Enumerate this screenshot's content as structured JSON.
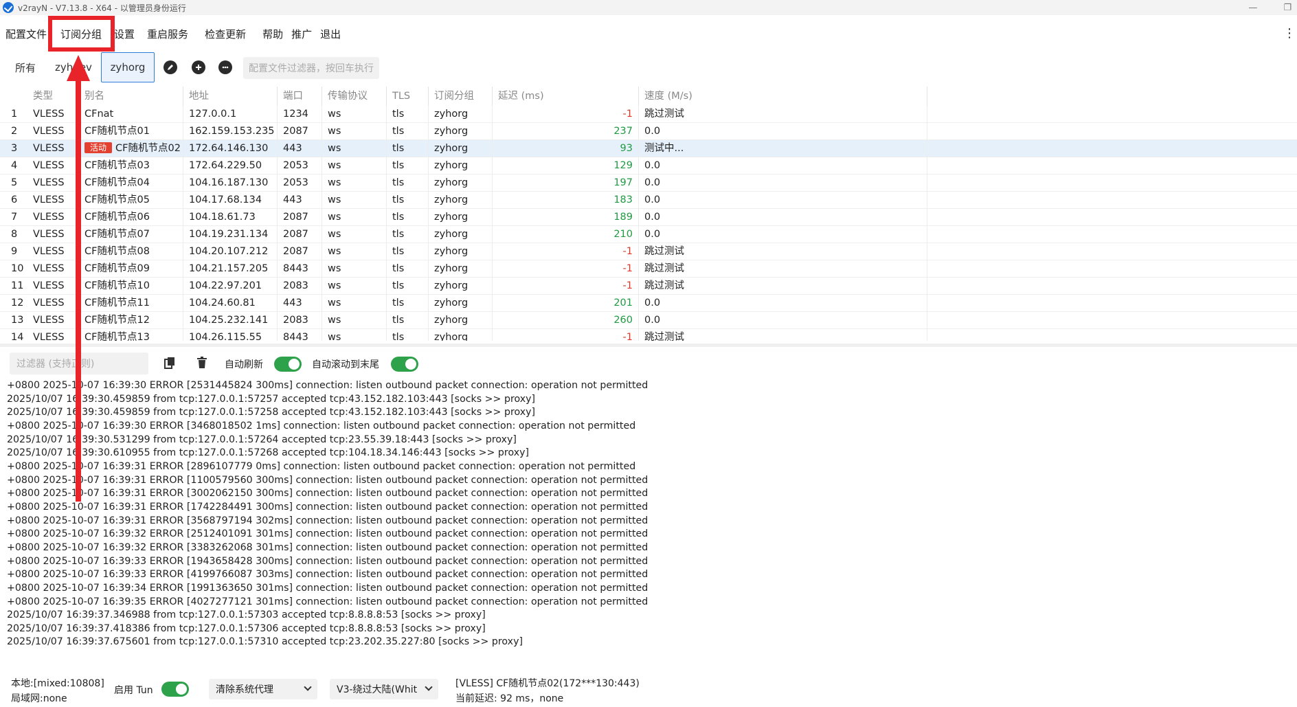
{
  "window": {
    "title": "v2rayN - V7.13.8 - X64 - 以管理员身份运行",
    "minimize": "—",
    "maximize": "❐"
  },
  "menu": [
    {
      "label": "配置文件"
    },
    {
      "label": "订阅分组"
    },
    {
      "label": "设置"
    },
    {
      "label": "重启服务"
    },
    {
      "label": "检查更新"
    },
    {
      "label": "帮助"
    },
    {
      "label": "推广"
    },
    {
      "label": "退出"
    }
  ],
  "menu_overflow": "⋮",
  "tabs": [
    {
      "label": "所有"
    },
    {
      "label": "zyhdev"
    },
    {
      "label": "zyhorg",
      "active": true
    }
  ],
  "toolbar_icons": [
    "edit-icon",
    "add-icon",
    "more-icon"
  ],
  "profile_filter": {
    "placeholder": "配置文件过滤器，按回车执行"
  },
  "table": {
    "columns": [
      "类型",
      "别名",
      "地址",
      "端口",
      "传输协议",
      "TLS",
      "订阅分组",
      "延迟 (ms)",
      "速度 (M/s)"
    ],
    "rows": [
      {
        "idx": "1",
        "type": "VLESS",
        "alias": "CFnat",
        "address": "127.0.0.1",
        "port": "1234",
        "transport": "ws",
        "tls": "tls",
        "group": "zyhorg",
        "latency": "-1",
        "speed": "跳过测试"
      },
      {
        "idx": "2",
        "type": "VLESS",
        "alias": "CF随机节点01",
        "address": "162.159.153.235",
        "port": "2087",
        "transport": "ws",
        "tls": "tls",
        "group": "zyhorg",
        "latency": "237",
        "speed": "0.0"
      },
      {
        "idx": "3",
        "type": "VLESS",
        "alias": "CF随机节点02",
        "badge": "活动",
        "address": "172.64.146.130",
        "port": "443",
        "transport": "ws",
        "tls": "tls",
        "group": "zyhorg",
        "latency": "93",
        "speed": "测试中...",
        "selected": true
      },
      {
        "idx": "4",
        "type": "VLESS",
        "alias": "CF随机节点03",
        "address": "172.64.229.50",
        "port": "2053",
        "transport": "ws",
        "tls": "tls",
        "group": "zyhorg",
        "latency": "129",
        "speed": "0.0"
      },
      {
        "idx": "5",
        "type": "VLESS",
        "alias": "CF随机节点04",
        "address": "104.16.187.130",
        "port": "2053",
        "transport": "ws",
        "tls": "tls",
        "group": "zyhorg",
        "latency": "197",
        "speed": "0.0"
      },
      {
        "idx": "6",
        "type": "VLESS",
        "alias": "CF随机节点05",
        "address": "104.17.68.134",
        "port": "443",
        "transport": "ws",
        "tls": "tls",
        "group": "zyhorg",
        "latency": "183",
        "speed": "0.0"
      },
      {
        "idx": "7",
        "type": "VLESS",
        "alias": "CF随机节点06",
        "address": "104.18.61.73",
        "port": "2087",
        "transport": "ws",
        "tls": "tls",
        "group": "zyhorg",
        "latency": "189",
        "speed": "0.0"
      },
      {
        "idx": "8",
        "type": "VLESS",
        "alias": "CF随机节点07",
        "address": "104.19.231.134",
        "port": "2087",
        "transport": "ws",
        "tls": "tls",
        "group": "zyhorg",
        "latency": "210",
        "speed": "0.0"
      },
      {
        "idx": "9",
        "type": "VLESS",
        "alias": "CF随机节点08",
        "address": "104.20.107.212",
        "port": "2087",
        "transport": "ws",
        "tls": "tls",
        "group": "zyhorg",
        "latency": "-1",
        "speed": "跳过测试"
      },
      {
        "idx": "10",
        "type": "VLESS",
        "alias": "CF随机节点09",
        "address": "104.21.157.205",
        "port": "8443",
        "transport": "ws",
        "tls": "tls",
        "group": "zyhorg",
        "latency": "-1",
        "speed": "跳过测试"
      },
      {
        "idx": "11",
        "type": "VLESS",
        "alias": "CF随机节点10",
        "address": "104.22.97.201",
        "port": "2083",
        "transport": "ws",
        "tls": "tls",
        "group": "zyhorg",
        "latency": "-1",
        "speed": "跳过测试"
      },
      {
        "idx": "12",
        "type": "VLESS",
        "alias": "CF随机节点11",
        "address": "104.24.60.81",
        "port": "443",
        "transport": "ws",
        "tls": "tls",
        "group": "zyhorg",
        "latency": "201",
        "speed": "0.0"
      },
      {
        "idx": "13",
        "type": "VLESS",
        "alias": "CF随机节点12",
        "address": "104.25.232.141",
        "port": "2083",
        "transport": "ws",
        "tls": "tls",
        "group": "zyhorg",
        "latency": "260",
        "speed": "0.0"
      },
      {
        "idx": "14",
        "type": "VLESS",
        "alias": "CF随机节点13",
        "address": "104.26.115.55",
        "port": "8443",
        "transport": "ws",
        "tls": "tls",
        "group": "zyhorg",
        "latency": "-1",
        "speed": "跳过测试"
      }
    ]
  },
  "logbar": {
    "filter_placeholder": "过滤器 (支持正则)",
    "auto_refresh_label": "自动刷新",
    "auto_refresh_on": true,
    "auto_scroll_label": "自动滚动到末尾",
    "auto_scroll_on": true
  },
  "log_lines": [
    "+0800 2025-10-07 16:39:30 ERROR [2531445824 300ms] connection: listen outbound packet connection: operation not permitted",
    "2025/10/07 16:39:30.459859 from tcp:127.0.0.1:57257 accepted tcp:43.152.182.103:443 [socks >> proxy]",
    "2025/10/07 16:39:30.459859 from tcp:127.0.0.1:57258 accepted tcp:43.152.182.103:443 [socks >> proxy]",
    "+0800 2025-10-07 16:39:30 ERROR [3468018502 1ms] connection: listen outbound packet connection: operation not permitted",
    "2025/10/07 16:39:30.531299 from tcp:127.0.0.1:57264 accepted tcp:23.55.39.18:443 [socks >> proxy]",
    "2025/10/07 16:39:30.610955 from tcp:127.0.0.1:57268 accepted tcp:104.18.34.146:443 [socks >> proxy]",
    "+0800 2025-10-07 16:39:31 ERROR [2896107779 0ms] connection: listen outbound packet connection: operation not permitted",
    "+0800 2025-10-07 16:39:31 ERROR [1100579560 300ms] connection: listen outbound packet connection: operation not permitted",
    "+0800 2025-10-07 16:39:31 ERROR [3002062150 300ms] connection: listen outbound packet connection: operation not permitted",
    "+0800 2025-10-07 16:39:31 ERROR [1742284491 300ms] connection: listen outbound packet connection: operation not permitted",
    "+0800 2025-10-07 16:39:31 ERROR [3568797194 302ms] connection: listen outbound packet connection: operation not permitted",
    "+0800 2025-10-07 16:39:32 ERROR [2512401091 301ms] connection: listen outbound packet connection: operation not permitted",
    "+0800 2025-10-07 16:39:32 ERROR [3383262068 301ms] connection: listen outbound packet connection: operation not permitted",
    "+0800 2025-10-07 16:39:33 ERROR [1943658428 300ms] connection: listen outbound packet connection: operation not permitted",
    "+0800 2025-10-07 16:39:33 ERROR [4199766087 303ms] connection: listen outbound packet connection: operation not permitted",
    "+0800 2025-10-07 16:39:34 ERROR [1991363650 301ms] connection: listen outbound packet connection: operation not permitted",
    "+0800 2025-10-07 16:39:35 ERROR [4027277121 301ms] connection: listen outbound packet connection: operation not permitted",
    "2025/10/07 16:39:37.346988 from tcp:127.0.0.1:57303 accepted tcp:8.8.8.8:53 [socks >> proxy]",
    "2025/10/07 16:39:37.418386 from tcp:127.0.0.1:57306 accepted tcp:8.8.8.8:53 [socks >> proxy]",
    "2025/10/07 16:39:37.675601 from tcp:127.0.0.1:57310 accepted tcp:23.202.35.227:80 [socks >> proxy]"
  ],
  "status": {
    "local": "本地:[mixed:10808]",
    "lan": "局域网:none",
    "tun_label": "启用 Tun",
    "tun_on": true,
    "system_proxy": "清除系统代理",
    "routing": "V3-绕过大陆(Whit",
    "current_node": "[VLESS] CF随机节点02(172***130:443)",
    "current_latency": "当前延迟: 92 ms，none"
  },
  "colors": {
    "accent": "#2f7bd8",
    "toggle_on": "#2ea24a",
    "latency_good": "#1f9a40",
    "latency_bad": "#e0362a",
    "badge": "#e4402f",
    "annotation": "#e8232a"
  }
}
